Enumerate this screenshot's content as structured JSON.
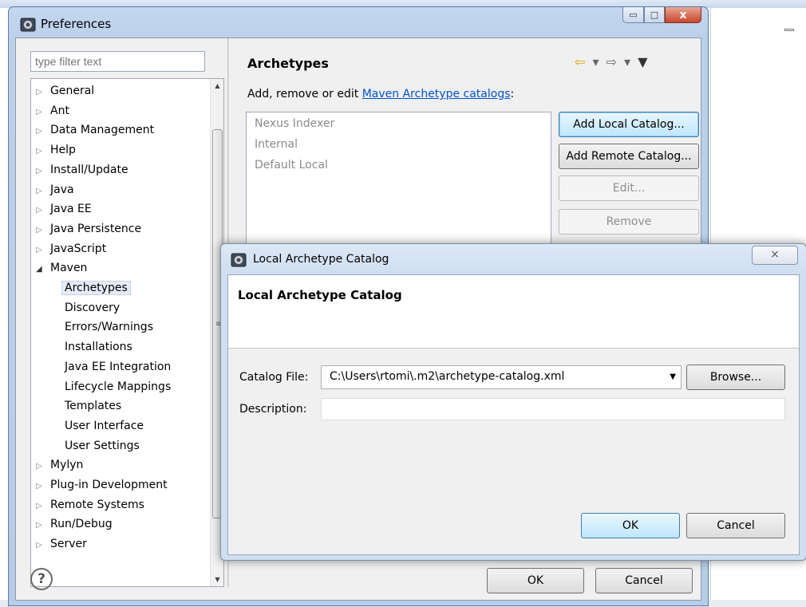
{
  "window": {
    "title": "Preferences",
    "min_label": "▭",
    "max_label": "□",
    "close_label": "x"
  },
  "filter": {
    "placeholder": "type filter text"
  },
  "tree": {
    "items": [
      {
        "label": "General",
        "level": 0,
        "state": "collapsed"
      },
      {
        "label": "Ant",
        "level": 0,
        "state": "collapsed"
      },
      {
        "label": "Data Management",
        "level": 0,
        "state": "collapsed"
      },
      {
        "label": "Help",
        "level": 0,
        "state": "collapsed"
      },
      {
        "label": "Install/Update",
        "level": 0,
        "state": "collapsed"
      },
      {
        "label": "Java",
        "level": 0,
        "state": "collapsed"
      },
      {
        "label": "Java EE",
        "level": 0,
        "state": "collapsed"
      },
      {
        "label": "Java Persistence",
        "level": 0,
        "state": "collapsed"
      },
      {
        "label": "JavaScript",
        "level": 0,
        "state": "collapsed"
      },
      {
        "label": "Maven",
        "level": 0,
        "state": "expanded"
      },
      {
        "label": "Archetypes",
        "level": 1,
        "state": "leaf",
        "selected": true
      },
      {
        "label": "Discovery",
        "level": 1,
        "state": "leaf"
      },
      {
        "label": "Errors/Warnings",
        "level": 1,
        "state": "leaf"
      },
      {
        "label": "Installations",
        "level": 1,
        "state": "leaf"
      },
      {
        "label": "Java EE Integration",
        "level": 1,
        "state": "leaf"
      },
      {
        "label": "Lifecycle Mappings",
        "level": 1,
        "state": "leaf"
      },
      {
        "label": "Templates",
        "level": 1,
        "state": "leaf"
      },
      {
        "label": "User Interface",
        "level": 1,
        "state": "leaf"
      },
      {
        "label": "User Settings",
        "level": 1,
        "state": "leaf"
      },
      {
        "label": "Mylyn",
        "level": 0,
        "state": "collapsed"
      },
      {
        "label": "Plug-in Development",
        "level": 0,
        "state": "collapsed"
      },
      {
        "label": "Remote Systems",
        "level": 0,
        "state": "collapsed"
      },
      {
        "label": "Run/Debug",
        "level": 0,
        "state": "collapsed"
      },
      {
        "label": "Server",
        "level": 0,
        "state": "collapsed"
      }
    ]
  },
  "page": {
    "title": "Archetypes",
    "desc_prefix": "Add, remove or edit ",
    "desc_link": "Maven Archetype catalogs",
    "desc_suffix": ":",
    "catalogs": [
      "Nexus Indexer",
      "Internal",
      "Default Local"
    ],
    "buttons": {
      "add_local": "Add Local Catalog...",
      "add_remote": "Add Remote Catalog...",
      "edit": "Edit...",
      "remove": "Remove"
    },
    "nav": {
      "back": "⇦",
      "forward": "⇨",
      "dropdown": "▾",
      "menu": "▼"
    }
  },
  "footer": {
    "help": "?",
    "ok": "OK",
    "cancel": "Cancel"
  },
  "dialog": {
    "title": "Local Archetype Catalog",
    "close": "⨯",
    "banner_title": "Local Archetype Catalog",
    "catalog_file_label": "Catalog File:",
    "catalog_file_value": "C:\\Users\\rtomi\\.m2\\archetype-catalog.xml",
    "browse": "Browse...",
    "description_label": "Description:",
    "description_value": "",
    "ok": "OK",
    "cancel": "Cancel"
  },
  "colors": {
    "link": "#0052cc",
    "selection": "#e5ecf8",
    "default_button": "#bee6fd"
  }
}
